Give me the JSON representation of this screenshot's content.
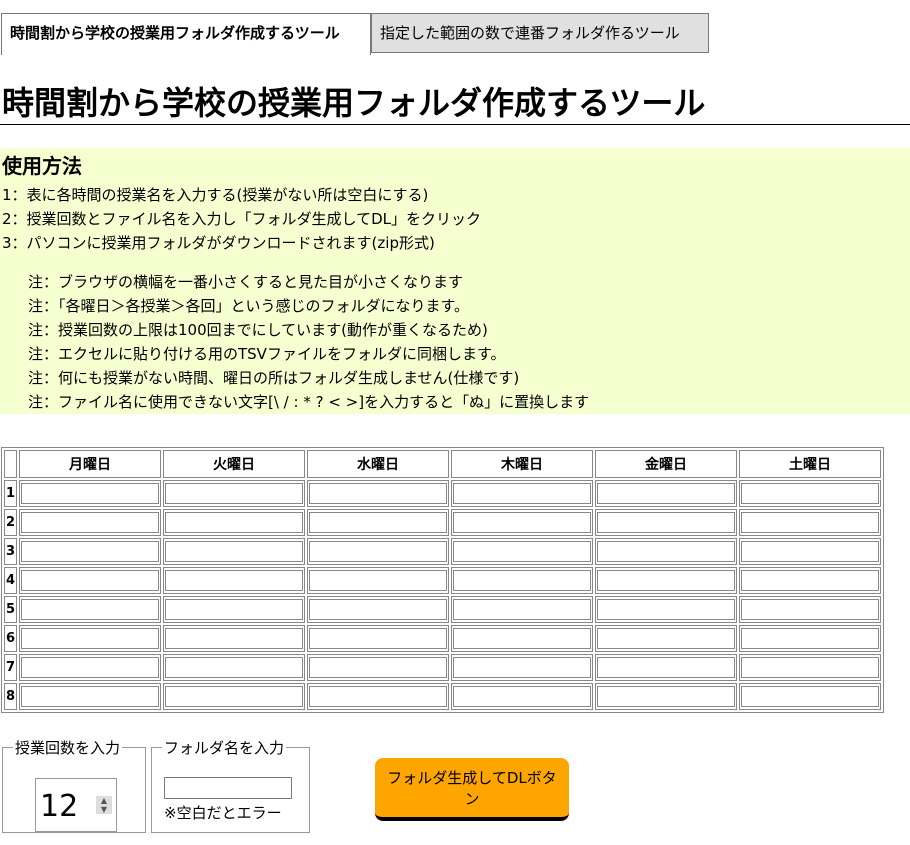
{
  "tabs": [
    {
      "label": "時間割から学校の授業用フォルダ作成するツール",
      "active": true
    },
    {
      "label": "指定した範囲の数で連番フォルダ作るツール",
      "active": false
    }
  ],
  "page_title": "時間割から学校の授業用フォルダ作成するツール",
  "usage": {
    "heading": "使用方法",
    "steps": [
      "1：表に各時間の授業名を入力する(授業がない所は空白にする)",
      "2：授業回数とファイル名を入力し「フォルダ生成してDL」をクリック",
      "3：パソコンに授業用フォルダがダウンロードされます(zip形式)"
    ],
    "notes": [
      "注：ブラウザの横幅を一番小さくすると見た目が小さくなります",
      "注：「各曜日＞各授業＞各回」という感じのフォルダになります。",
      "注：授業回数の上限は100回までにしています(動作が重くなるため)",
      "注：エクセルに貼り付ける用のTSVファイルをフォルダに同梱します。",
      "注：何にも授業がない時間、曜日の所はフォルダ生成しません(仕様です)",
      "注：ファイル名に使用できない文字[\\ / : * ? < >]を入力すると「ぬ」に置換します"
    ]
  },
  "timetable": {
    "days": [
      "月曜日",
      "火曜日",
      "水曜日",
      "木曜日",
      "金曜日",
      "土曜日"
    ],
    "periods": [
      "1",
      "2",
      "3",
      "4",
      "5",
      "6",
      "7",
      "8"
    ]
  },
  "lesson_count": {
    "legend": "授業回数を入力",
    "value": "12"
  },
  "folder_name": {
    "legend": "フォルダ名を入力",
    "value": "",
    "hint": "※空白だとエラー"
  },
  "generate_button": {
    "label": "フォルダ生成してDLボタン"
  },
  "colors": {
    "usage_bg": "#f5ffd0",
    "button_bg": "#ffa500",
    "inactive_tab_bg": "#e0e0e0"
  }
}
